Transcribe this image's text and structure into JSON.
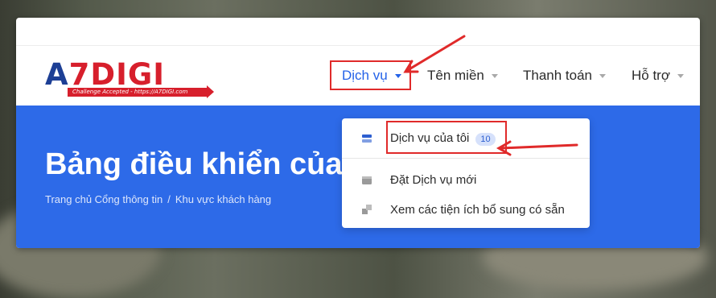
{
  "brand": {
    "logo_main": "DIGI",
    "logo_prefix": "A",
    "logo_seven": "7",
    "tagline": "Challenge Accepted - https://A7DIGI.com"
  },
  "nav": {
    "items": [
      {
        "label": "Dịch vụ",
        "active": true
      },
      {
        "label": "Tên miền",
        "active": false
      },
      {
        "label": "Thanh toán",
        "active": false
      },
      {
        "label": "Hỗ trợ",
        "active": false
      }
    ]
  },
  "hero": {
    "title": "Bảng điều khiển của",
    "breadcrumb": [
      "Trang chủ Cổng thông tin",
      "Khu vực khách hàng"
    ],
    "breadcrumb_separator": "/"
  },
  "dropdown": {
    "items": [
      {
        "label": "Dịch vụ của tôi",
        "badge": "10",
        "icon": "server-icon"
      },
      {
        "label": "Đặt Dịch vụ mới",
        "icon": "box-icon"
      },
      {
        "label": "Xem các tiện ích bổ sung có sẵn",
        "icon": "addons-icon"
      }
    ]
  },
  "colors": {
    "accent": "#2d6ae8",
    "annotation": "#e02a2a",
    "brand_red": "#d71f2c",
    "brand_blue": "#1d3f95"
  }
}
